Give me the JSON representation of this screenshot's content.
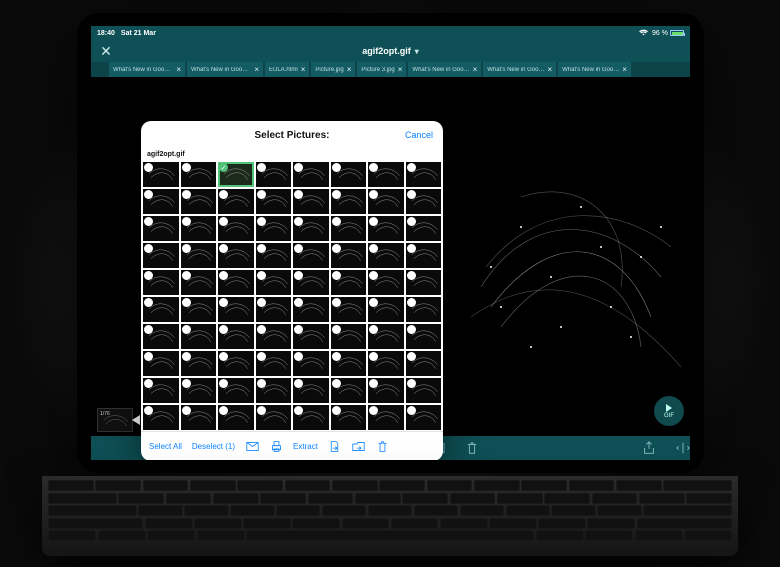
{
  "status": {
    "time": "18:40",
    "date": "Sat 21 Mar",
    "battery_pct": "96 %"
  },
  "title": "agif2opt.gif",
  "tabs": [
    {
      "label": "What's New in Good…"
    },
    {
      "label": "What's New in Good…"
    },
    {
      "label": "EULA.html"
    },
    {
      "label": "Picture.jpg"
    },
    {
      "label": "Picture 3.jpg"
    },
    {
      "label": "What's New in Goo…"
    },
    {
      "label": "What's New in Goo…"
    },
    {
      "label": "What's New in Goo…"
    }
  ],
  "popover": {
    "title": "Select Pictures:",
    "cancel": "Cancel",
    "filename": "agif2opt.gif",
    "selected_index": 2,
    "footer": {
      "select_all": "Select All",
      "deselect": "Deselect (1)",
      "extract": "Extract"
    }
  },
  "gif_button_label": "GIF",
  "frame_label": "1/76"
}
